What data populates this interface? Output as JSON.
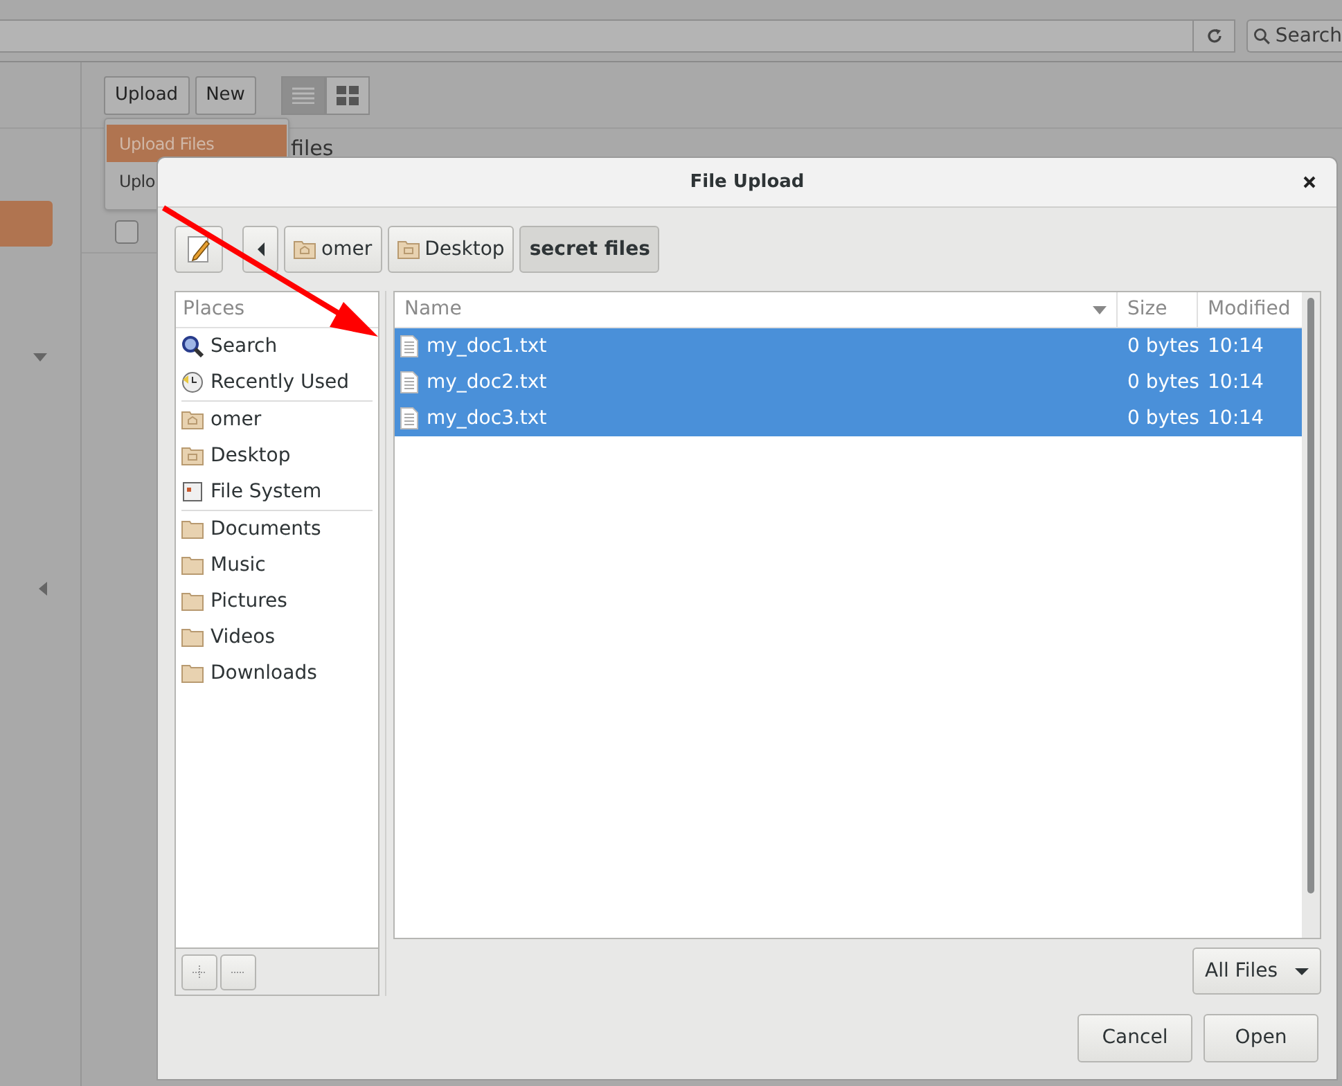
{
  "browser": {
    "search_placeholder": "Search"
  },
  "toolbar": {
    "buttons": [
      "Upload",
      "New"
    ],
    "views": [
      {
        "kind": "list",
        "selected": true
      },
      {
        "kind": "grid",
        "selected": false
      }
    ]
  },
  "upload_menu": [
    {
      "label": "Upload Files",
      "selected": true
    },
    {
      "label": "Uplo",
      "selected": false
    }
  ],
  "content": {
    "heading": "files",
    "checkbox": {
      "checked": false
    }
  },
  "dialog": {
    "title": "File Upload",
    "path": [
      {
        "label": "omer",
        "kind": "home",
        "selected": false
      },
      {
        "label": "Desktop",
        "kind": "desktop",
        "selected": false
      },
      {
        "label": "secret files",
        "kind": "plain",
        "selected": true
      }
    ],
    "places_header": "Places",
    "places": [
      [
        {
          "label": "Search",
          "kind": "search"
        },
        {
          "label": "Recently Used",
          "kind": "recent"
        }
      ],
      [
        {
          "label": "omer",
          "kind": "home"
        },
        {
          "label": "Desktop",
          "kind": "desktop"
        },
        {
          "label": "File System",
          "kind": "drive"
        }
      ],
      [
        {
          "label": "Documents",
          "kind": "folder"
        },
        {
          "label": "Music",
          "kind": "folder"
        },
        {
          "label": "Pictures",
          "kind": "folder"
        },
        {
          "label": "Videos",
          "kind": "folder"
        },
        {
          "label": "Downloads",
          "kind": "folder"
        }
      ]
    ],
    "columns": [
      "Name",
      "Size",
      "Modified"
    ],
    "files": [
      {
        "name": "my_doc1.txt",
        "size": "0 bytes",
        "modified": "10:14",
        "selected": true
      },
      {
        "name": "my_doc2.txt",
        "size": "0 bytes",
        "modified": "10:14",
        "selected": true
      },
      {
        "name": "my_doc3.txt",
        "size": "0 bytes",
        "modified": "10:14",
        "selected": true
      }
    ],
    "filter": "All Files",
    "buttons": [
      "Cancel",
      "Open"
    ]
  }
}
